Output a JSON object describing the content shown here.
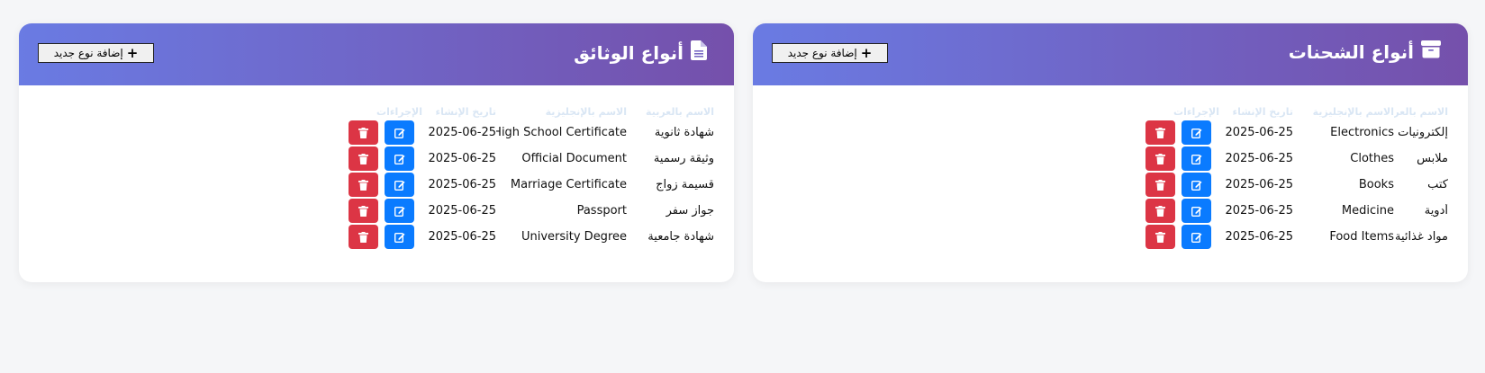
{
  "panels": [
    {
      "title": "أنواع الوثائق",
      "icon": "document-icon",
      "add_label": "إضافة نوع جديد",
      "columns": [
        "الاسم بالعربية",
        "الاسم بالإنجليزية",
        "تاريخ الإنشاء",
        "الإجراءات"
      ],
      "rows": [
        {
          "ar": "شهادة ثانوية",
          "en": "High School Certificate",
          "date": "2025-06-25"
        },
        {
          "ar": "وثيقة رسمية",
          "en": "Official Document",
          "date": "2025-06-25"
        },
        {
          "ar": "قسيمة زواج",
          "en": "Marriage Certificate",
          "date": "2025-06-25"
        },
        {
          "ar": "جواز سفر",
          "en": "Passport",
          "date": "2025-06-25"
        },
        {
          "ar": "شهادة جامعية",
          "en": "University Degree",
          "date": "2025-06-25"
        }
      ]
    },
    {
      "title": "أنواع الشحنات",
      "icon": "box-icon",
      "add_label": "إضافة نوع جديد",
      "columns": [
        "الاسم بالعربية",
        "الاسم بالإنجليزية",
        "تاريخ الإنشاء",
        "الإجراءات"
      ],
      "rows": [
        {
          "ar": "إلكترونيات",
          "en": "Electronics",
          "date": "2025-06-25"
        },
        {
          "ar": "ملابس",
          "en": "Clothes",
          "date": "2025-06-25"
        },
        {
          "ar": "كتب",
          "en": "Books",
          "date": "2025-06-25"
        },
        {
          "ar": "أدوية",
          "en": "Medicine",
          "date": "2025-06-25"
        },
        {
          "ar": "مواد غذائية",
          "en": "Food Items",
          "date": "2025-06-25"
        }
      ]
    }
  ],
  "colors": {
    "header_start": "#6a7be3",
    "header_end": "#7550ab",
    "edit": "#0a7bff",
    "delete": "#dc3545"
  }
}
